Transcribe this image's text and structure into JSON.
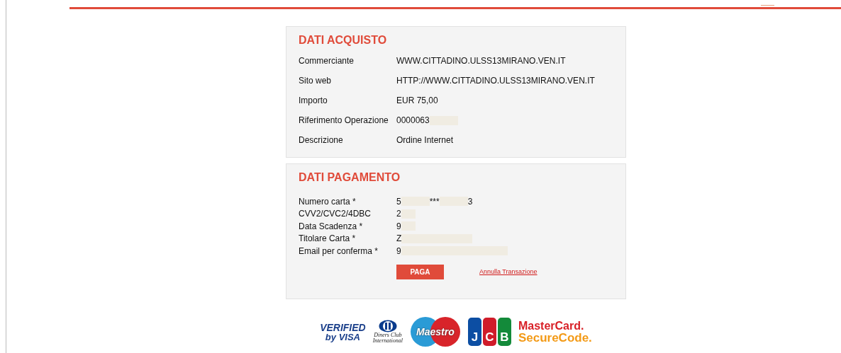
{
  "purchase": {
    "title": "DATI ACQUISTO",
    "rows": [
      {
        "label": "Commerciante",
        "value": "WWW.CITTADINO.ULSS13MIRANO.VEN.IT"
      },
      {
        "label": "Sito web",
        "value": "HTTP://WWW.CITTADINO.ULSS13MIRANO.VEN.IT"
      },
      {
        "label": "Importo",
        "value": "EUR 75,00"
      },
      {
        "label": "Riferimento Operazione",
        "parts": [
          {
            "kind": "text",
            "text": "0000063"
          },
          {
            "kind": "mask"
          }
        ]
      },
      {
        "label": "Descrizione",
        "value": "Ordine Internet"
      }
    ]
  },
  "payment": {
    "title": "DATI PAGAMENTO",
    "rows": [
      {
        "label": "Numero carta *",
        "parts": [
          {
            "kind": "text",
            "text": "5"
          },
          {
            "kind": "mask"
          },
          {
            "kind": "text",
            "text": "***"
          },
          {
            "kind": "mask"
          },
          {
            "kind": "text",
            "text": "3"
          }
        ]
      },
      {
        "label": "CVV2/CVC2/4DBC",
        "parts": [
          {
            "kind": "text",
            "text": "2"
          },
          {
            "kind": "shortmask"
          }
        ]
      },
      {
        "label": "Data Scadenza *",
        "parts": [
          {
            "kind": "text",
            "text": "9"
          },
          {
            "kind": "shortmask"
          }
        ]
      },
      {
        "label": "Titolare Carta *",
        "parts": [
          {
            "kind": "text",
            "text": "Z"
          },
          {
            "kind": "longmask"
          }
        ]
      },
      {
        "label": "Email per conferma *",
        "parts": [
          {
            "kind": "text",
            "text": "9"
          },
          {
            "kind": "widemask"
          }
        ]
      }
    ],
    "pay_button": "PAGA",
    "cancel_link": "Annulla Transazione"
  },
  "logos": [
    {
      "kind": "verified",
      "lines": [
        "VERIFIED",
        "by VISA"
      ]
    },
    {
      "kind": "diners",
      "lines": [
        "Diners Club",
        "International"
      ]
    },
    {
      "kind": "maestro",
      "lines": [
        "Maestro"
      ]
    },
    {
      "kind": "jcb",
      "lines": [
        "J",
        "C",
        "B"
      ]
    },
    {
      "kind": "securecode",
      "lines": [
        "MasterCard.",
        "SecureCode."
      ]
    }
  ]
}
